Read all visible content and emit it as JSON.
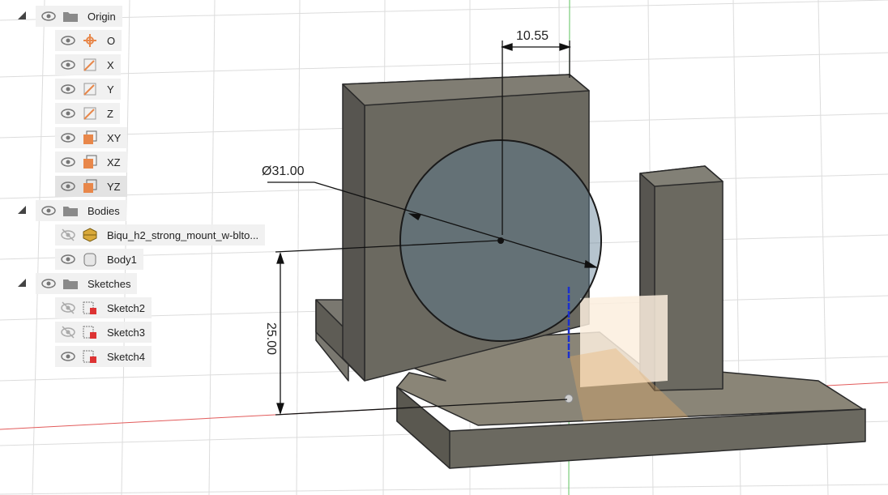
{
  "browser": {
    "origin": {
      "label": "Origin",
      "items": [
        {
          "label": "O"
        },
        {
          "label": "X"
        },
        {
          "label": "Y"
        },
        {
          "label": "Z"
        },
        {
          "label": "XY"
        },
        {
          "label": "XZ"
        },
        {
          "label": "YZ"
        }
      ]
    },
    "bodies": {
      "label": "Bodies",
      "items": [
        {
          "label": "Biqu_h2_strong_mount_w-blto..."
        },
        {
          "label": "Body1"
        }
      ]
    },
    "sketches": {
      "label": "Sketches",
      "items": [
        {
          "label": "Sketch2"
        },
        {
          "label": "Sketch3"
        },
        {
          "label": "Sketch4"
        }
      ]
    }
  },
  "dimensions": {
    "width": "10.55",
    "diameter": "Ø31.00",
    "height": "25.00"
  },
  "colors": {
    "plane_orange": "#e8874a",
    "axis_red": "#e25b5b",
    "axis_green": "#5fc35f",
    "axis_blue": "#1a2fd0",
    "body_grey": "#6b6960"
  }
}
